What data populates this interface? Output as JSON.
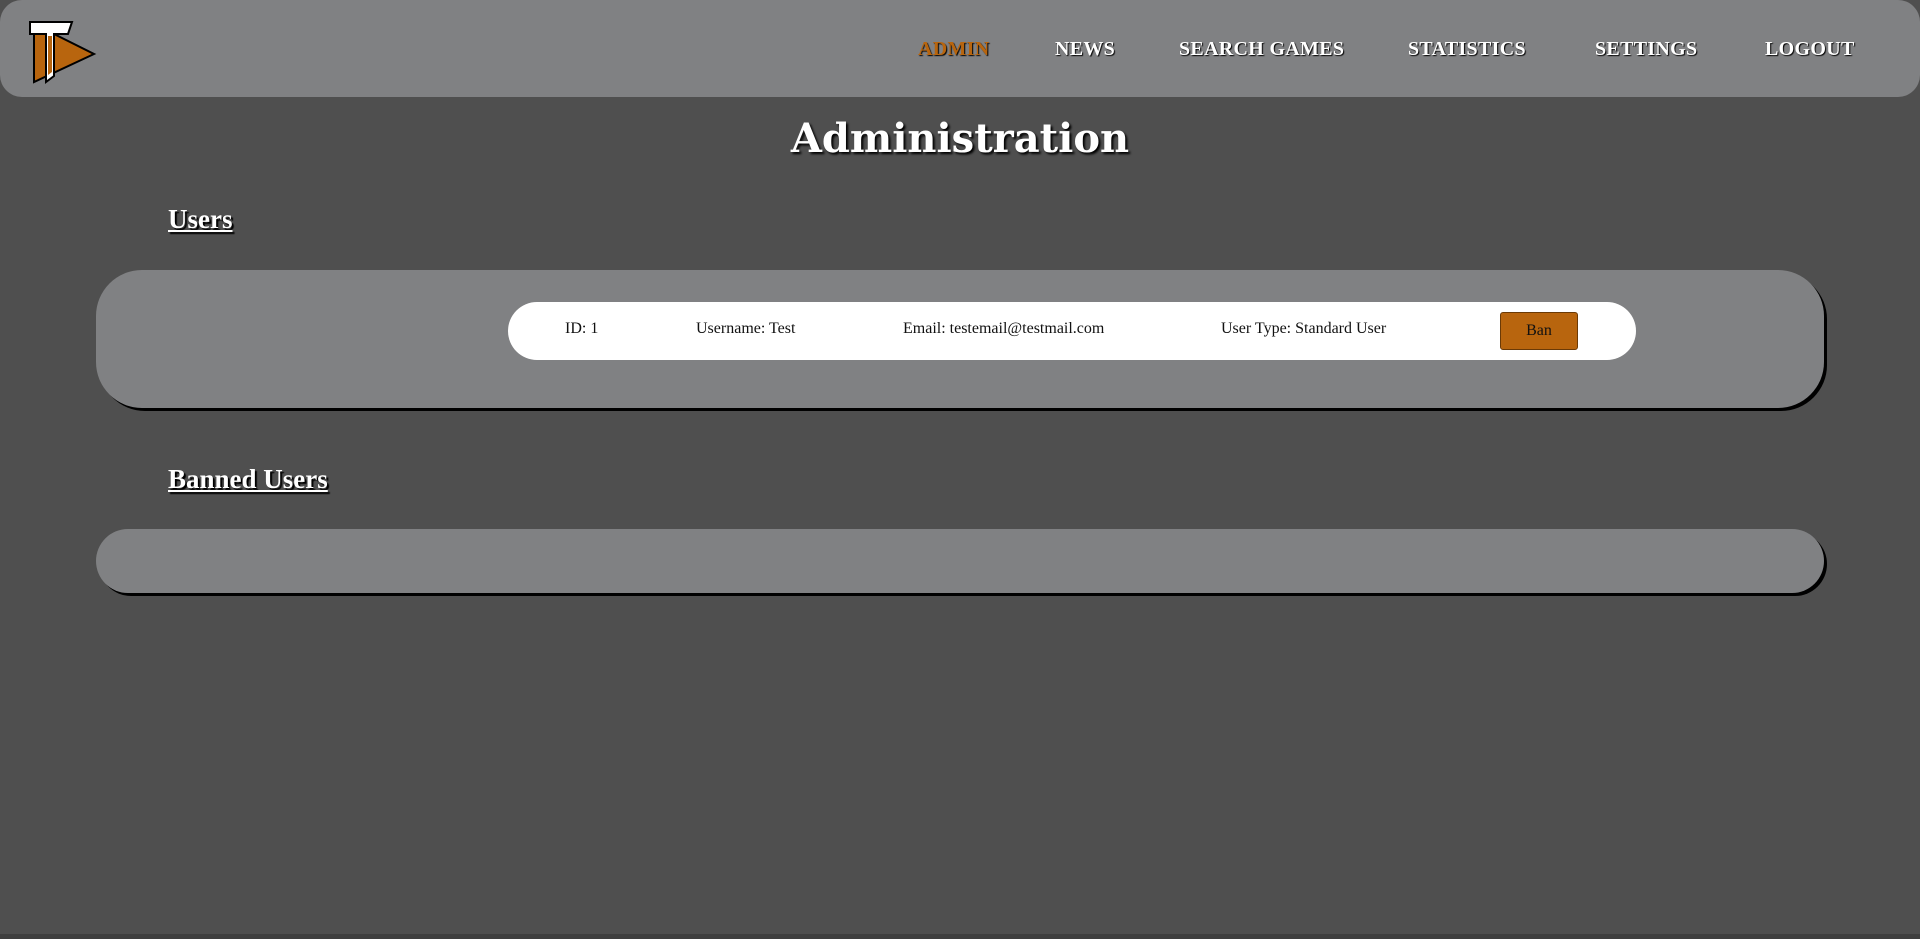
{
  "nav": {
    "items": [
      {
        "label": "ADMIN",
        "active": true
      },
      {
        "label": "NEWS",
        "active": false
      },
      {
        "label": "SEARCH GAMES",
        "active": false
      },
      {
        "label": "STATISTICS",
        "active": false
      },
      {
        "label": "SETTINGS",
        "active": false
      },
      {
        "label": "LOGOUT",
        "active": false
      }
    ]
  },
  "logo": {
    "icon": "tt-logo-icon",
    "colors": {
      "primary": "#b8650e",
      "secondary": "#ffffff"
    }
  },
  "page": {
    "title": "Administration"
  },
  "users_section": {
    "title": "Users",
    "rows": [
      {
        "id": "ID: 1",
        "username": "Username: Test",
        "email": "Email: testemail@testmail.com",
        "user_type": "User Type: Standard User",
        "action_label": "Ban"
      }
    ]
  },
  "banned_section": {
    "title": "Banned Users",
    "rows": []
  },
  "colors": {
    "background": "#4f4f4f",
    "panel": "#808183",
    "accent": "#b8650e",
    "text": "#ffffff"
  }
}
